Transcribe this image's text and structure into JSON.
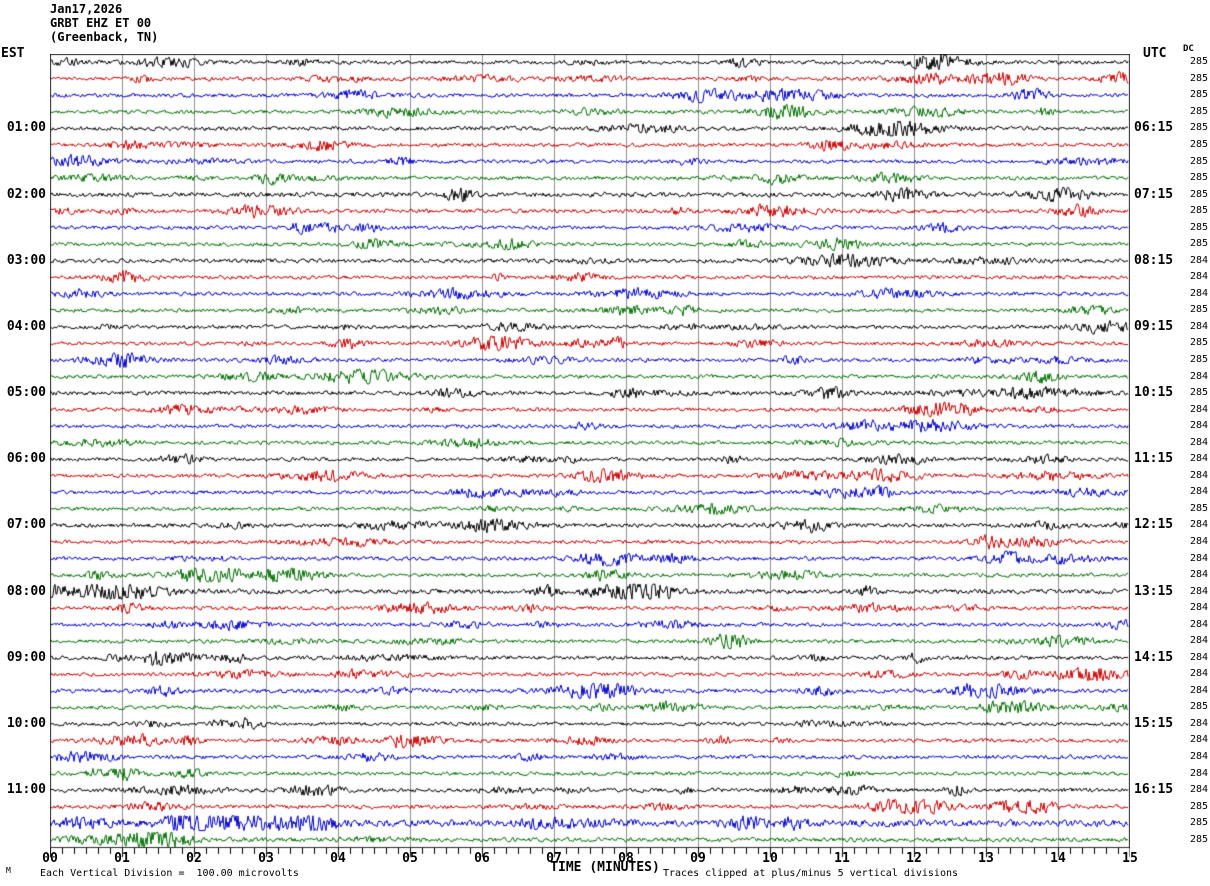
{
  "header": {
    "date": "Jan17,2026",
    "station": "GRBT EHZ ET 00",
    "location": "(Greenback, TN)"
  },
  "left_axis": {
    "label": "EST",
    "hours": [
      "01:00",
      "02:00",
      "03:00",
      "04:00",
      "05:00",
      "06:00",
      "07:00",
      "08:00",
      "09:00",
      "10:00",
      "11:00"
    ]
  },
  "right_axis": {
    "label": "UTC",
    "dc_header": "DC",
    "hours": [
      "06:15",
      "07:15",
      "08:15",
      "09:15",
      "10:15",
      "11:15",
      "12:15",
      "13:15",
      "14:15",
      "15:15",
      "16:15"
    ],
    "dc_values": [
      285,
      285,
      285,
      285,
      285,
      285,
      285,
      285,
      285,
      285,
      285,
      285,
      284,
      284,
      284,
      285,
      284,
      285,
      285,
      284,
      285,
      284,
      284,
      284,
      284,
      284,
      284,
      285,
      284,
      284,
      284,
      284,
      284,
      284,
      284,
      284,
      284,
      284,
      284,
      285,
      284,
      284,
      284,
      284,
      284,
      285,
      285,
      285
    ]
  },
  "x_axis": {
    "ticks": [
      "00",
      "01",
      "02",
      "03",
      "04",
      "05",
      "06",
      "07",
      "08",
      "09",
      "10",
      "11",
      "12",
      "13",
      "14",
      "15"
    ],
    "label": "TIME (MINUTES)"
  },
  "footer": {
    "scale_note": "Each Vertical Division =  100.00 microvolts",
    "clip_note": "Traces clipped at plus/minus 5 vertical divisions",
    "corner_mark": "M"
  },
  "chart_data": {
    "type": "line",
    "description": "Helicorder seismogram: 12 hours of data, 48 trace lines of 15 minutes each, 4 lines per hour cycling black/red/blue/green; left labels EST line start times, right labels UTC line end times, DC offset value per line.",
    "start_time_est": "00:00",
    "end_time_est": "12:00",
    "minutes_per_line": 15,
    "lines": 48,
    "x_range_minutes": [
      0,
      15
    ],
    "major_tick_minutes": 1,
    "minor_tick_seconds": 10,
    "trace_colors": [
      "#000000",
      "#cc0000",
      "#0000cc",
      "#007000"
    ],
    "grid_color": "#8f8f8f",
    "border_color": "#2a2a2a",
    "clip_divisions": 5,
    "microvolts_per_division": 100.0,
    "row_activity": [
      1.0,
      1.0,
      1.0,
      1.0,
      1.1,
      1.0,
      1.0,
      1.0,
      1.25,
      1.1,
      1.0,
      1.0,
      1.1,
      1.0,
      1.0,
      1.0,
      1.0,
      1.0,
      1.05,
      1.0,
      1.1,
      1.0,
      1.0,
      1.0,
      1.0,
      1.0,
      1.0,
      1.0,
      1.1,
      1.0,
      1.05,
      1.0,
      1.2,
      1.0,
      1.0,
      1.0,
      1.05,
      1.0,
      1.1,
      1.0,
      1.0,
      1.0,
      1.05,
      1.0,
      1.1,
      1.05,
      1.8,
      1.15
    ]
  }
}
